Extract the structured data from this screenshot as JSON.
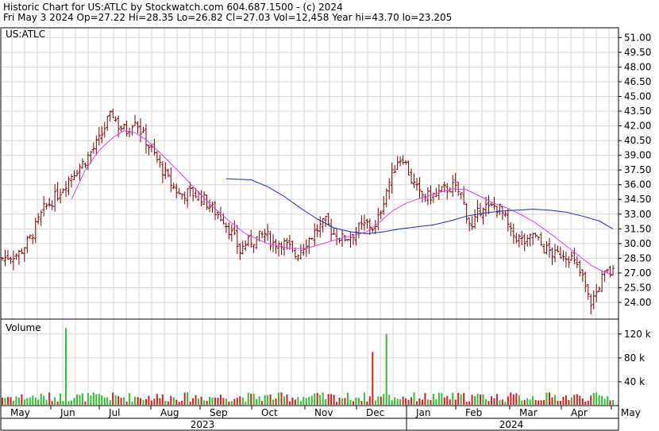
{
  "header": {
    "line1": "Historic Chart for US:ATLC by Stockwatch.com 604.687.1500 - (c) 2024",
    "line2": "Fri May  3 2024  Op=27.22  Hi=28.35  Lo=26.82  Cl=27.03  Vol=12,458  Year hi=43.70  lo=23.205"
  },
  "chart_data": {
    "type": "candlestick-ohlc",
    "symbol": "US:ATLC",
    "price_axis": {
      "ylim": [
        22.3,
        52.0
      ],
      "ticks": [
        "51.00",
        "49.50",
        "48.00",
        "46.50",
        "45.00",
        "43.50",
        "42.00",
        "40.50",
        "39.00",
        "37.50",
        "36.00",
        "34.50",
        "33.00",
        "31.50",
        "30.00",
        "28.50",
        "27.00",
        "25.50",
        "24.00"
      ]
    },
    "volume_axis": {
      "label": "Volume",
      "ylim": [
        0,
        145000
      ],
      "ticks": [
        "120 k",
        "80 k",
        "40 k"
      ]
    },
    "x_axis": {
      "months": [
        "May",
        "Jun",
        "Jul",
        "Aug",
        "Sep",
        "Oct",
        "Nov",
        "Dec",
        "Jan",
        "Feb",
        "Mar",
        "Apr",
        "May"
      ],
      "years": [
        "2023",
        "2024"
      ]
    },
    "price_path": [
      [
        0,
        28.5
      ],
      [
        6,
        29.0
      ],
      [
        10,
        30.5
      ],
      [
        15,
        33.5
      ],
      [
        20,
        35.0
      ],
      [
        25,
        37.0
      ],
      [
        30,
        38.5
      ],
      [
        35,
        40.5
      ],
      [
        38,
        42.5
      ],
      [
        40,
        43.2
      ],
      [
        42,
        42.0
      ],
      [
        45,
        41.5
      ],
      [
        48,
        42.8
      ],
      [
        50,
        41.5
      ],
      [
        53,
        40.0
      ],
      [
        56,
        38.5
      ],
      [
        60,
        36.5
      ],
      [
        64,
        35.0
      ],
      [
        68,
        35.2
      ],
      [
        72,
        34.8
      ],
      [
        76,
        33.5
      ],
      [
        80,
        32.5
      ],
      [
        84,
        30.5
      ],
      [
        86,
        29.2
      ],
      [
        88,
        30.0
      ],
      [
        92,
        30.5
      ],
      [
        95,
        31.0
      ],
      [
        98,
        30.0
      ],
      [
        101,
        30.2
      ],
      [
        104,
        29.5
      ],
      [
        106,
        28.8
      ],
      [
        108,
        29.5
      ],
      [
        111,
        30.5
      ],
      [
        114,
        31.5
      ],
      [
        117,
        32.2
      ],
      [
        120,
        31.0
      ],
      [
        123,
        30.5
      ],
      [
        126,
        30.8
      ],
      [
        129,
        31.5
      ],
      [
        132,
        32.0
      ],
      [
        135,
        31.5
      ],
      [
        137,
        33.5
      ],
      [
        139,
        35.5
      ],
      [
        141,
        37.0
      ],
      [
        143,
        38.5
      ],
      [
        145,
        38.8
      ],
      [
        148,
        36.5
      ],
      [
        151,
        35.0
      ],
      [
        154,
        34.8
      ],
      [
        157,
        35.0
      ],
      [
        160,
        35.5
      ],
      [
        163,
        35.8
      ],
      [
        166,
        35.0
      ],
      [
        168,
        33.0
      ],
      [
        170,
        31.5
      ],
      [
        172,
        33.0
      ],
      [
        174,
        34.0
      ],
      [
        176,
        33.5
      ],
      [
        178,
        33.8
      ],
      [
        180,
        33.5
      ],
      [
        182,
        32.5
      ],
      [
        184,
        31.0
      ],
      [
        187,
        30.5
      ],
      [
        190,
        30.0
      ],
      [
        192,
        31.0
      ],
      [
        194,
        30.2
      ],
      [
        196,
        29.5
      ],
      [
        198,
        29.2
      ],
      [
        200,
        28.8
      ],
      [
        203,
        29.0
      ],
      [
        206,
        28.5
      ],
      [
        208,
        27.5
      ],
      [
        210,
        26.5
      ],
      [
        212,
        24.5
      ],
      [
        213,
        24.0
      ],
      [
        215,
        25.0
      ],
      [
        217,
        26.5
      ],
      [
        219,
        27.0
      ],
      [
        221,
        27.03
      ]
    ],
    "volume_spikes": [
      [
        23,
        130000
      ],
      [
        134,
        90000
      ],
      [
        139,
        120000
      ]
    ],
    "volume_base": 18000,
    "ma_pink": [
      [
        25,
        34.5
      ],
      [
        30,
        37.5
      ],
      [
        35,
        39.5
      ],
      [
        40,
        40.8
      ],
      [
        44,
        41.5
      ],
      [
        48,
        41.3
      ],
      [
        52,
        40.6
      ],
      [
        58,
        39.0
      ],
      [
        64,
        37.3
      ],
      [
        70,
        35.5
      ],
      [
        76,
        33.8
      ],
      [
        82,
        32.3
      ],
      [
        88,
        31.0
      ],
      [
        96,
        30.0
      ],
      [
        104,
        29.5
      ],
      [
        110,
        29.5
      ],
      [
        116,
        30.0
      ],
      [
        122,
        30.5
      ],
      [
        128,
        30.9
      ],
      [
        132,
        31.2
      ],
      [
        137,
        32.3
      ],
      [
        141,
        33.3
      ],
      [
        146,
        34.1
      ],
      [
        152,
        34.7
      ],
      [
        158,
        35.2
      ],
      [
        163,
        35.6
      ],
      [
        168,
        35.5
      ],
      [
        173,
        34.8
      ],
      [
        178,
        34.1
      ],
      [
        183,
        33.6
      ],
      [
        188,
        32.9
      ],
      [
        193,
        32.1
      ],
      [
        198,
        31.1
      ],
      [
        203,
        30.0
      ],
      [
        208,
        28.9
      ],
      [
        213,
        27.8
      ],
      [
        217,
        27.2
      ],
      [
        221,
        26.8
      ]
    ],
    "ma_blue": [
      [
        81,
        36.6
      ],
      [
        90,
        36.5
      ],
      [
        96,
        35.8
      ],
      [
        102,
        34.8
      ],
      [
        108,
        33.6
      ],
      [
        114,
        32.5
      ],
      [
        120,
        31.6
      ],
      [
        126,
        31.2
      ],
      [
        132,
        31.0
      ],
      [
        138,
        31.2
      ],
      [
        144,
        31.5
      ],
      [
        150,
        31.7
      ],
      [
        156,
        31.9
      ],
      [
        162,
        32.3
      ],
      [
        168,
        32.8
      ],
      [
        174,
        33.1
      ],
      [
        180,
        33.3
      ],
      [
        186,
        33.4
      ],
      [
        192,
        33.5
      ],
      [
        198,
        33.4
      ],
      [
        204,
        33.2
      ],
      [
        210,
        32.8
      ],
      [
        216,
        32.3
      ],
      [
        221,
        31.5
      ]
    ],
    "grid": "on",
    "colors": {
      "bars": "#7a0000",
      "up_volume": "#2fbf2f",
      "down_volume": "#d02020",
      "ma_pink": "#e040e0",
      "ma_blue": "#1a2ab5"
    }
  }
}
